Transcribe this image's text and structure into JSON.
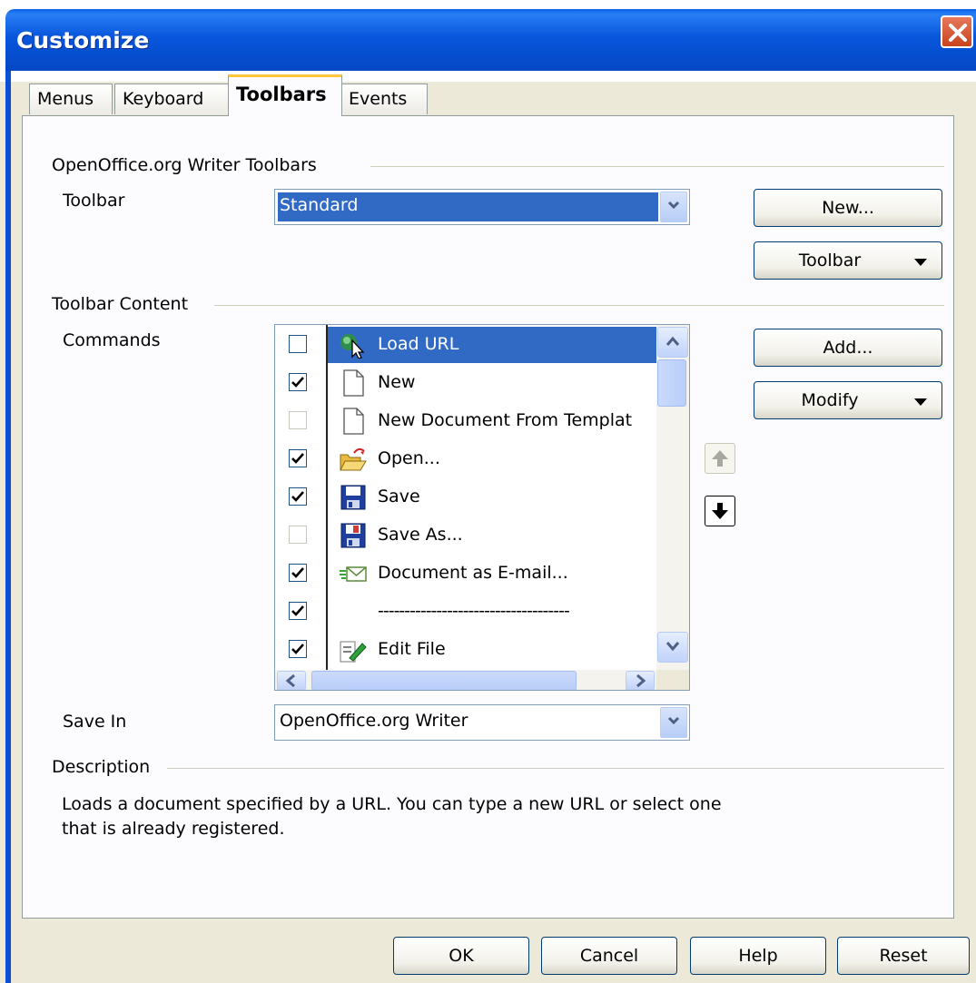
{
  "window": {
    "title": "Customize"
  },
  "tabs": [
    {
      "label": "Menus"
    },
    {
      "label": "Keyboard"
    },
    {
      "label": "Toolbars",
      "active": true
    },
    {
      "label": "Events"
    }
  ],
  "toolbars_section": {
    "heading": "OpenOffice.org Writer Toolbars",
    "toolbar_label": "Toolbar",
    "toolbar_value": "Standard",
    "new_button": "New...",
    "toolbar_menu_button": "Toolbar"
  },
  "content_section": {
    "heading": "Toolbar Content",
    "commands_label": "Commands",
    "add_button": "Add...",
    "modify_button": "Modify",
    "commands": [
      {
        "label": "Load URL",
        "checked": false,
        "selected": true,
        "icon": "load-url-icon"
      },
      {
        "label": "New",
        "checked": true,
        "icon": "new-document-icon"
      },
      {
        "label": "New Document From Templat",
        "checked": false,
        "icon": "new-document-icon"
      },
      {
        "label": "Open...",
        "checked": true,
        "icon": "open-folder-icon"
      },
      {
        "label": "Save",
        "checked": true,
        "icon": "save-icon"
      },
      {
        "label": "Save As...",
        "checked": false,
        "icon": "save-as-icon"
      },
      {
        "label": "Document as E-mail...",
        "checked": true,
        "icon": "email-icon"
      },
      {
        "label": "------------------------------------",
        "checked": true,
        "icon": ""
      },
      {
        "label": "Edit File",
        "checked": true,
        "icon": "edit-file-icon"
      }
    ],
    "save_in_label": "Save In",
    "save_in_value": "OpenOffice.org Writer"
  },
  "description_section": {
    "heading": "Description",
    "text_line1": "Loads a document specified by a URL. You can type a new URL or select one",
    "text_line2": "that is already registered."
  },
  "footer": {
    "ok": "OK",
    "cancel": "Cancel",
    "help": "Help",
    "reset": "Reset"
  },
  "colors": {
    "title_bar": "#0856dc",
    "selection": "#316ac5",
    "dialog_bg": "#ece9d8"
  }
}
